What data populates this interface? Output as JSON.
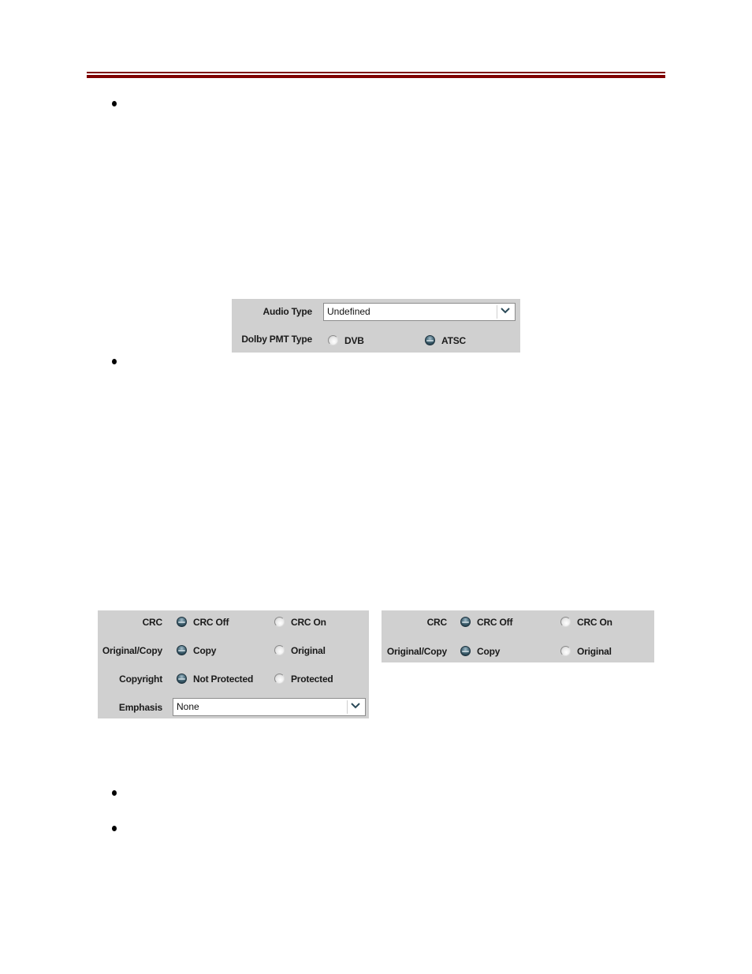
{
  "document": {
    "accent_color": "#7f0000",
    "bullets": [
      "",
      "",
      "",
      ""
    ]
  },
  "audio_panel": {
    "audio_type": {
      "label": "Audio Type",
      "value": "Undefined"
    },
    "dolby_pmt_type": {
      "label": "Dolby PMT Type",
      "options": [
        {
          "label": "DVB",
          "selected": false
        },
        {
          "label": "ATSC",
          "selected": true
        }
      ]
    }
  },
  "left_panel": {
    "crc": {
      "label": "CRC",
      "options": [
        {
          "label": "CRC Off",
          "selected": true
        },
        {
          "label": "CRC On",
          "selected": false
        }
      ]
    },
    "original_copy": {
      "label": "Original/Copy",
      "options": [
        {
          "label": "Copy",
          "selected": true
        },
        {
          "label": "Original",
          "selected": false
        }
      ]
    },
    "copyright": {
      "label": "Copyright",
      "options": [
        {
          "label": "Not Protected",
          "selected": true
        },
        {
          "label": "Protected",
          "selected": false
        }
      ]
    },
    "emphasis": {
      "label": "Emphasis",
      "value": "None"
    }
  },
  "right_panel": {
    "crc": {
      "label": "CRC",
      "options": [
        {
          "label": "CRC Off",
          "selected": true
        },
        {
          "label": "CRC On",
          "selected": false
        }
      ]
    },
    "original_copy": {
      "label": "Original/Copy",
      "options": [
        {
          "label": "Copy",
          "selected": true
        },
        {
          "label": "Original",
          "selected": false
        }
      ]
    }
  }
}
